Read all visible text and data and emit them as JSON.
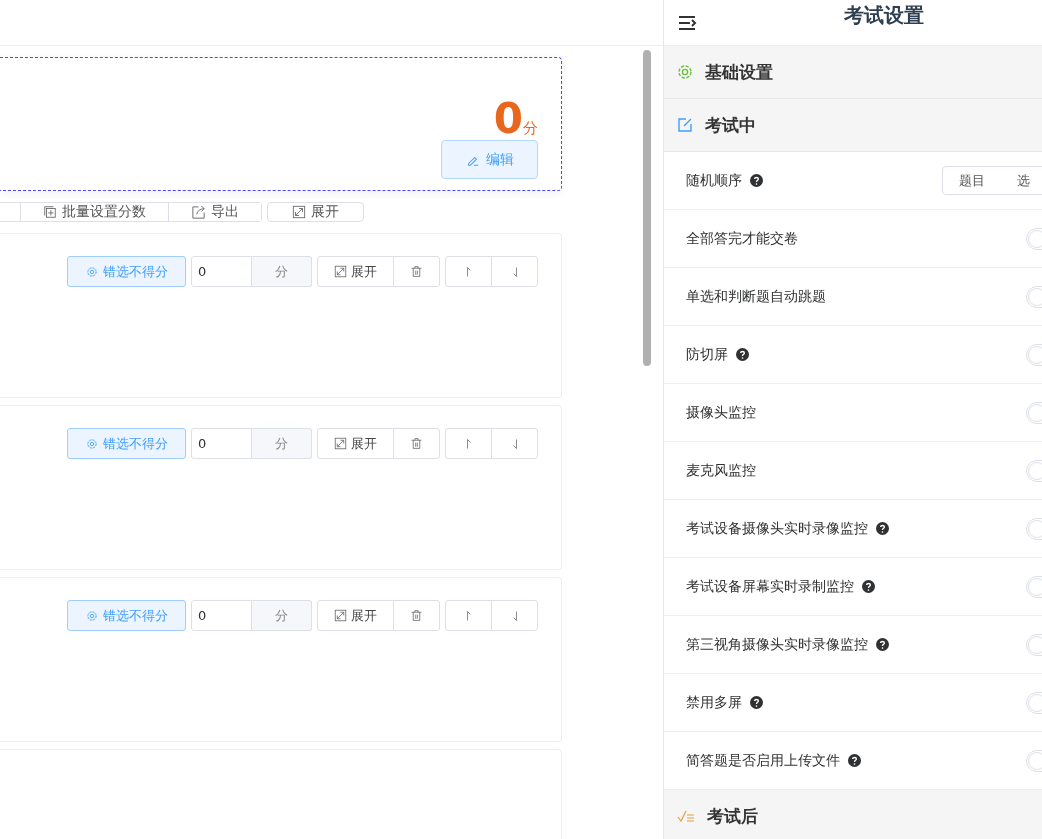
{
  "score_card": {
    "score": "0",
    "unit": "分",
    "edit_button": "编辑"
  },
  "toolbar": [
    {
      "kind": "batch",
      "label": "批量设置分数"
    },
    {
      "kind": "export",
      "label": "导出"
    },
    {
      "kind": "expand",
      "label": "展开"
    }
  ],
  "question_cards": [
    {
      "wrong_choice_button": "错选不得分",
      "score_value": "0",
      "score_unit": "分",
      "expand_button": "展开"
    },
    {
      "wrong_choice_button": "错选不得分",
      "score_value": "0",
      "score_unit": "分",
      "expand_button": "展开"
    },
    {
      "wrong_choice_button": "错选不得分",
      "score_value": "0",
      "score_unit": "分",
      "expand_button": "展开"
    }
  ],
  "settings_panel": {
    "title": "考试设置",
    "sections": [
      {
        "kind": "gear",
        "title": "基础设置"
      },
      {
        "kind": "edit",
        "title": "考试中",
        "rows": [
          {
            "kind": "segmented",
            "label": "随机顺序",
            "help": true,
            "options": [
              "题目",
              "选"
            ]
          },
          {
            "kind": "switch",
            "label": "全部答完才能交卷",
            "help": false,
            "on": false
          },
          {
            "kind": "switch",
            "label": "单选和判断题自动跳题",
            "help": false,
            "on": false
          },
          {
            "kind": "switch",
            "label": "防切屏",
            "help": true,
            "on": false
          },
          {
            "kind": "switch",
            "label": "摄像头监控",
            "help": false,
            "on": false
          },
          {
            "kind": "switch",
            "label": "麦克风监控",
            "help": false,
            "on": false
          },
          {
            "kind": "switch",
            "label": "考试设备摄像头实时录像监控",
            "help": true,
            "on": false
          },
          {
            "kind": "switch",
            "label": "考试设备屏幕实时录制监控",
            "help": true,
            "on": false
          },
          {
            "kind": "switch",
            "label": "第三视角摄像头实时录像监控",
            "help": true,
            "on": false
          },
          {
            "kind": "switch",
            "label": "禁用多屏",
            "help": true,
            "on": false
          },
          {
            "kind": "switch",
            "label": "简答题是否启用上传文件",
            "help": true,
            "on": false
          }
        ]
      },
      {
        "kind": "check",
        "title": "考试后"
      }
    ]
  }
}
